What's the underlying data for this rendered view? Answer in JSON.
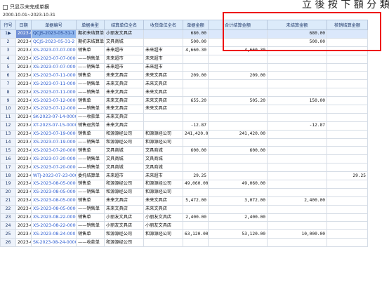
{
  "hint_text": "立 後 按 下 額 分 類",
  "filter": {
    "checkbox_label": "只显示未完成单据"
  },
  "date_range": "2000-10-01~2023-10-31",
  "columns": [
    "行号",
    "日期",
    "单据编号",
    "单据类型",
    "结算单位全名",
    "收货单位全名",
    "单据金额",
    "合计结算金额",
    "未结算金额",
    "核销结算金额"
  ],
  "rows": [
    [
      "1",
      "2023-05-",
      "QCJS-2023-05-31-1",
      "期初未结算单",
      "小丽友文具店",
      "",
      "680.00",
      "",
      "680.00",
      ""
    ],
    [
      "2",
      "2023-05-",
      "QCJS-2023-05-31-2",
      "期初未结算单",
      "文具商城",
      "",
      "500.00",
      "",
      "500.00",
      ""
    ],
    [
      "3",
      "2023-07-",
      "XS-2023-07-07-00002",
      "销售单",
      "未来超市",
      "未来超市",
      "4,660.30",
      "4,660.30",
      "",
      ""
    ],
    [
      "4",
      "2023-07-",
      "XS-2023-07-07-00002",
      "——销售单",
      "未来超市",
      "未来超市",
      "",
      "",
      "",
      ""
    ],
    [
      "5",
      "2023-07-",
      "XS-2023-07-07-00002",
      "——销售单",
      "未来超市",
      "未来超市",
      "",
      "",
      "",
      ""
    ],
    [
      "6",
      "2023-07-",
      "XS-2023-07-11-00003",
      "销售单",
      "未来文具店",
      "未来文具店",
      "209.00",
      "209.00",
      "",
      ""
    ],
    [
      "7",
      "2023-07-",
      "XS-2023-07-11-00003",
      "——销售单",
      "未来文具店",
      "未来文具店",
      "",
      "",
      "",
      ""
    ],
    [
      "8",
      "2023-07-",
      "XS-2023-07-11-00003",
      "——销售单",
      "未来文具店",
      "未来文具店",
      "",
      "",
      "",
      ""
    ],
    [
      "9",
      "2023-07-",
      "XS-2023-07-12-00001",
      "销售单",
      "未来文具店",
      "未来文具店",
      "655.20",
      "505.20",
      "150.00",
      ""
    ],
    [
      "10",
      "2023-07-",
      "XS-2023-07-12-00001",
      "——销售单",
      "未来文具店",
      "未来文具店",
      "",
      "",
      "",
      ""
    ],
    [
      "11",
      "2023-07-",
      "SK-2023-07-14-00002",
      "——收款单",
      "未来文具店",
      "",
      "",
      "",
      "",
      ""
    ],
    [
      "12",
      "2023-07-",
      "XT-2023-07-15-00001",
      "销售退货单",
      "未来文具店",
      "",
      "-12.87",
      "",
      "-12.87",
      ""
    ],
    [
      "13",
      "2023-07-",
      "XS-2023-07-19-00004",
      "销售单",
      "和源源经公司",
      "和源源经公司",
      "241,420.00",
      "241,420.00",
      "",
      ""
    ],
    [
      "14",
      "2023-07-",
      "XS-2023-07-19-00004",
      "——销售单",
      "和源源经公司",
      "和源源经公司",
      "",
      "",
      "",
      ""
    ],
    [
      "15",
      "2023-07-",
      "XS-2023-07-20-00005",
      "销售单",
      "文具商城",
      "文具商城",
      "600.00",
      "600.00",
      "",
      ""
    ],
    [
      "16",
      "2023-07-",
      "XS-2023-07-20-00005",
      "——销售单",
      "文具商城",
      "文具商城",
      "",
      "",
      "",
      ""
    ],
    [
      "17",
      "2023-07-",
      "XS-2023-07-20-00005",
      "——销售单",
      "文具商城",
      "文具商城",
      "",
      "",
      "",
      ""
    ],
    [
      "18",
      "2023-07-",
      "WTJ-2023-07-23-00001",
      "委托结算单",
      "未来超市",
      "未来超市",
      "29.25",
      "",
      "",
      "29.25"
    ],
    [
      "19",
      "2023-08-",
      "XS-2023-08-05-00006",
      "销售单",
      "和源源经公司",
      "和源源经公司",
      "49,060.00",
      "49,060.00",
      "",
      ""
    ],
    [
      "20",
      "2023-08-",
      "XS-2023-08-05-00006",
      "——销售单",
      "和源源经公司",
      "和源源经公司",
      "",
      "",
      "",
      ""
    ],
    [
      "21",
      "2023-08-",
      "XS-2023-08-05-00007",
      "销售单",
      "未来文具店",
      "未来文具店",
      "5,472.00",
      "3,072.00",
      "2,400.00",
      ""
    ],
    [
      "22",
      "2023-08-",
      "XS-2023-08-05-00007",
      "——销售单",
      "未来文具店",
      "未来文具店",
      "",
      "",
      "",
      ""
    ],
    [
      "23",
      "2023-08-",
      "XS-2023-08-22-00009",
      "销售单",
      "小丽友文具店",
      "小丽友文具店",
      "2,400.00",
      "2,400.00",
      "",
      ""
    ],
    [
      "24",
      "2023-08-",
      "XS-2023-08-22-00009",
      "——销售单",
      "小丽友文具店",
      "小丽友文具店",
      "",
      "",
      "",
      ""
    ],
    [
      "25",
      "2023-08-",
      "XS-2023-08-24-00010",
      "销售单",
      "和源源经公司",
      "和源源经公司",
      "63,120.00",
      "53,120.00",
      "10,000.00",
      ""
    ],
    [
      "26",
      "2023-08-",
      "SK-2023-08-24-00004",
      "——收款单",
      "和源源经公司",
      "",
      "",
      "",
      "",
      ""
    ]
  ]
}
